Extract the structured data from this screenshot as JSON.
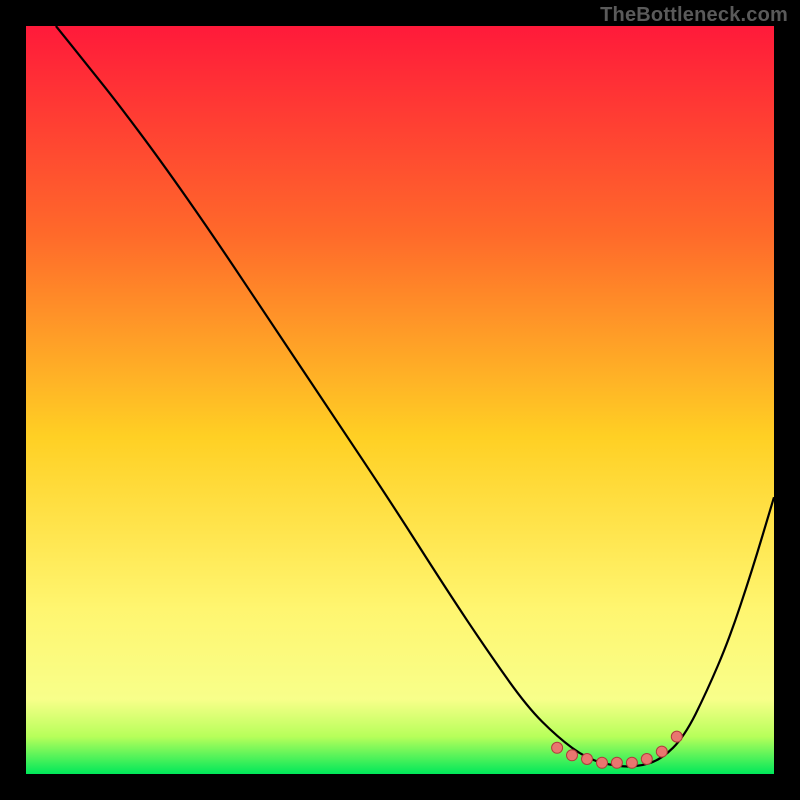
{
  "watermark": "TheBottleneck.com",
  "colors": {
    "bg": "#000000",
    "watermark": "#5a5a5a",
    "curve": "#000000",
    "marker_fill": "#e9766f",
    "marker_stroke": "#b13c3c",
    "grad_top": "#ff1a3a",
    "grad_mid1": "#ff6a2a",
    "grad_mid2": "#ffd024",
    "grad_low": "#fff670",
    "grad_bottom_y": "#f8ff8a",
    "grad_green1": "#b7ff5a",
    "grad_green2": "#00e85a"
  },
  "chart_data": {
    "type": "line",
    "title": "",
    "xlabel": "",
    "ylabel": "",
    "xlim": [
      0,
      100
    ],
    "ylim": [
      0,
      100
    ],
    "series": [
      {
        "name": "bottleneck-curve",
        "x": [
          4,
          8,
          12,
          18,
          25,
          33,
          41,
          49,
          56,
          62,
          67,
          71,
          75,
          79,
          82,
          85,
          88,
          91,
          94,
          97,
          100
        ],
        "y": [
          100,
          95,
          90,
          82,
          72,
          60,
          48,
          36,
          25,
          16,
          9,
          5,
          2,
          1,
          1,
          2,
          5,
          11,
          18,
          27,
          37
        ]
      }
    ],
    "flat_region": {
      "x": [
        71,
        73,
        75,
        77,
        79,
        81,
        83,
        85,
        87
      ],
      "y": [
        3.5,
        2.5,
        2,
        1.5,
        1.5,
        1.5,
        2,
        3,
        5
      ]
    }
  }
}
